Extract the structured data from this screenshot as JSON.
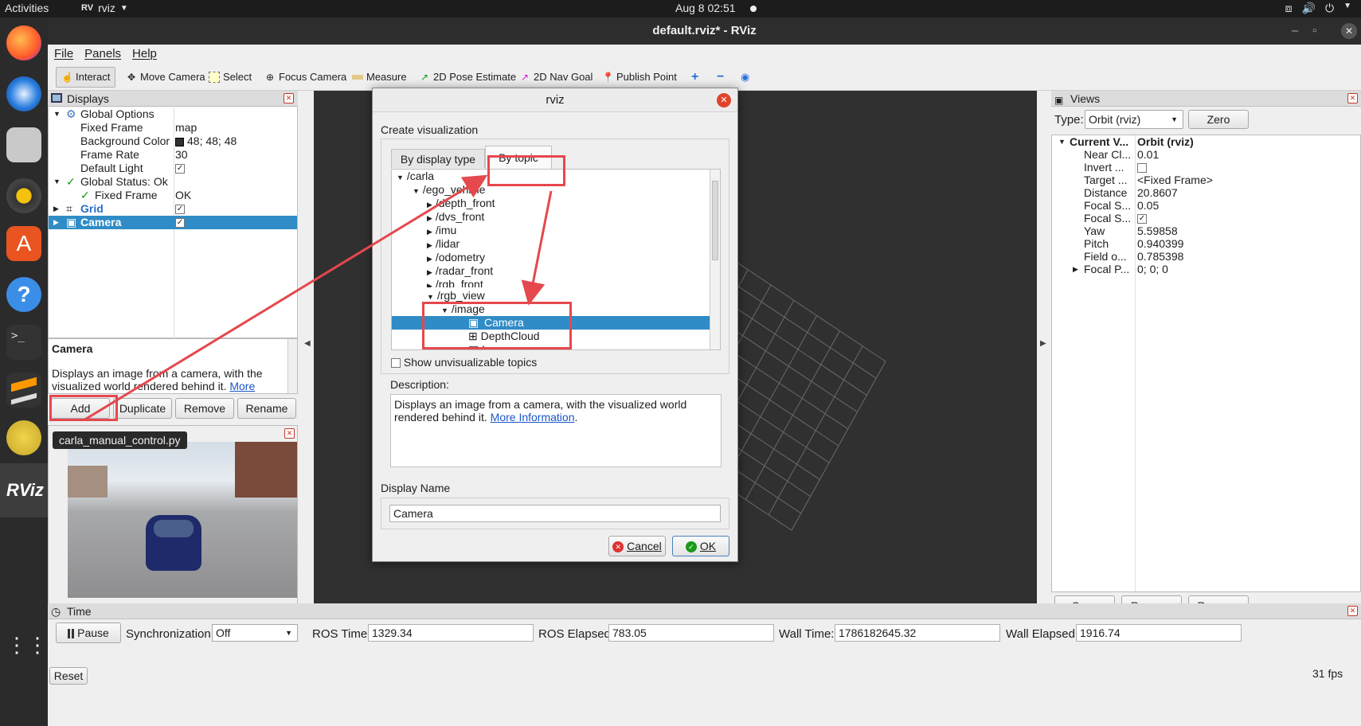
{
  "topbar": {
    "activities": "Activities",
    "app_name": "rviz",
    "clock": "Aug 8  02:51"
  },
  "window": {
    "title": "default.rviz* - RViz"
  },
  "menu": {
    "file": "File",
    "panels": "Panels",
    "help": "Help"
  },
  "toolbar": {
    "interact": "Interact",
    "move_camera": "Move Camera",
    "select": "Select",
    "focus_camera": "Focus Camera",
    "measure": "Measure",
    "pose_estimate": "2D Pose Estimate",
    "nav_goal": "2D Nav Goal",
    "publish_point": "Publish Point"
  },
  "displays": {
    "title": "Displays",
    "rows": [
      {
        "label": "Global Options"
      },
      {
        "label": "Fixed Frame",
        "value": "map"
      },
      {
        "label": "Background Color",
        "value": "48; 48; 48"
      },
      {
        "label": "Frame Rate",
        "value": "30"
      },
      {
        "label": "Default Light"
      },
      {
        "label": "Global Status: Ok"
      },
      {
        "label": "Fixed Frame",
        "value": "OK"
      },
      {
        "label": "Grid"
      },
      {
        "label": "Camera"
      }
    ],
    "desc_title": "Camera",
    "desc_text": "Displays an image from a camera, with the visualized world rendered behind it.",
    "desc_link": "More",
    "buttons": {
      "add": "Add",
      "duplicate": "Duplicate",
      "remove": "Remove",
      "rename": "Rename"
    }
  },
  "tooltip": "carla_manual_control.py",
  "dialog": {
    "title": "rviz",
    "heading": "Create visualization",
    "tab_display_type": "By display type",
    "tab_topic": "By topic",
    "tree": [
      "/carla",
      "/ego_vehicle",
      "/depth_front",
      "/dvs_front",
      "/imu",
      "/lidar",
      "/odometry",
      "/radar_front",
      "/rgb_front",
      "/rgb_view",
      "/image",
      "Camera",
      "DepthCloud",
      "Image"
    ],
    "show_unvis": "Show unvisualizable topics",
    "desc_label": "Description:",
    "desc_text": "Displays an image from a camera, with the visualized world rendered behind it.",
    "desc_link": "More Information",
    "name_label": "Display Name",
    "name_value": "Camera",
    "cancel": "Cancel",
    "ok": "OK"
  },
  "views": {
    "title": "Views",
    "type_label": "Type:",
    "type_value": "Orbit (rviz)",
    "zero": "Zero",
    "rows": [
      {
        "label": "Current V...",
        "value": "Orbit (rviz)"
      },
      {
        "label": "Near Cl...",
        "value": "0.01"
      },
      {
        "label": "Invert ...",
        "value": ""
      },
      {
        "label": "Target ...",
        "value": "<Fixed Frame>"
      },
      {
        "label": "Distance",
        "value": "20.8607"
      },
      {
        "label": "Focal S...",
        "value": "0.05"
      },
      {
        "label": "Focal S...",
        "value": ""
      },
      {
        "label": "Yaw",
        "value": "5.59858"
      },
      {
        "label": "Pitch",
        "value": "0.940399"
      },
      {
        "label": "Field o...",
        "value": "0.785398"
      },
      {
        "label": "Focal P...",
        "value": "0; 0; 0"
      }
    ],
    "buttons": {
      "save": "Save",
      "remove": "Remove",
      "rename": "Rename"
    }
  },
  "time": {
    "title": "Time",
    "pause": "Pause",
    "sync_label": "Synchronization:",
    "sync_value": "Off",
    "ros_time_label": "ROS Time:",
    "ros_time": "1329.34",
    "ros_elapsed_label": "ROS Elapsed:",
    "ros_elapsed": "783.05",
    "wall_time_label": "Wall Time:",
    "wall_time": "1786182645.32",
    "wall_elapsed_label": "Wall Elapsed:",
    "wall_elapsed": "1916.74",
    "reset": "Reset",
    "fps": "31 fps"
  }
}
